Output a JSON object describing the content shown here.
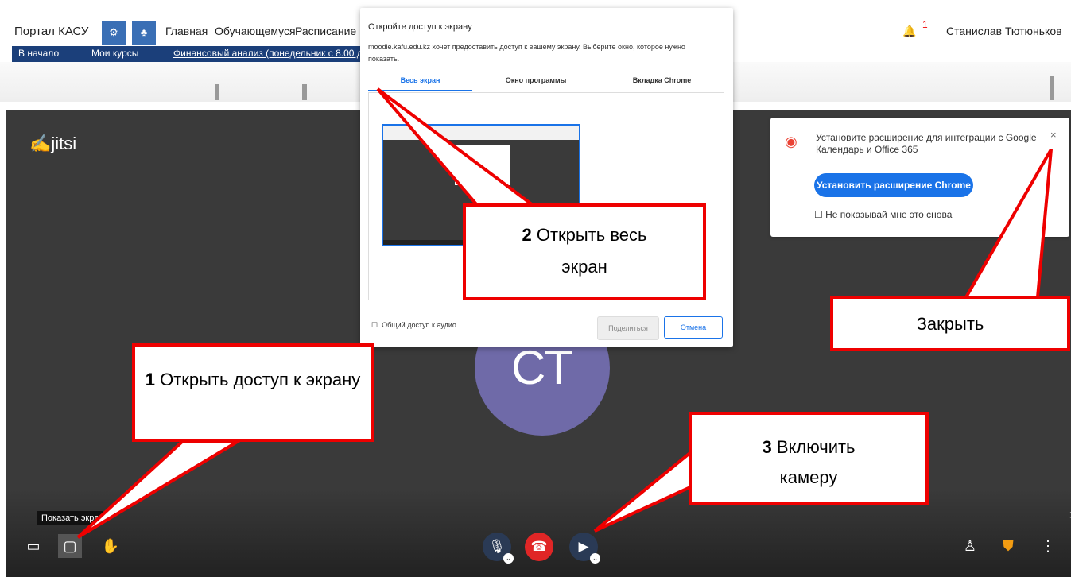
{
  "moodle": {
    "site_name": "Портал КАСУ",
    "nav_items": [
      "Главная",
      "Обучающемуся",
      "Расписание"
    ],
    "user_name": "Станислав Тютюньков",
    "notification_count": "1",
    "breadcrumbs": [
      "В начало",
      "Мои курсы",
      "Финансовый анализ (понедельник с 8.00 д"
    ]
  },
  "jitsi": {
    "logo": "jitsi",
    "avatar_initials": "СТ",
    "tooltip": "Показать экра"
  },
  "extension_popup": {
    "text": "Установите расширение для интеграции с Google Календарь и Office 365",
    "button": "Установить расширение Chrome",
    "checkbox_label": "Не показывай мне это снова",
    "close": "×"
  },
  "share_dialog": {
    "title": "Откройте доступ к экрану",
    "description": "moodle.kafu.edu.kz хочет предоставить доступ к вашему экрану. Выберите окно, которое нужно показать.",
    "tabs": [
      "Весь экран",
      "Окно программы",
      "Вкладка Chrome"
    ],
    "audio_label": "Общий доступ к аудио",
    "share_button": "Поделиться",
    "cancel_button": "Отмена"
  },
  "callouts": {
    "c1_num": "1",
    "c1_text": "Открыть доступ к экрану",
    "c2_num": "2",
    "c2_text": "Открыть весь экран",
    "c3_num": "3",
    "c3_text": "Включить камеру",
    "close_text": "Закрыть"
  },
  "colors": {
    "accent": "#1a73e8",
    "callout_border": "#e00000",
    "hangup": "#e02626",
    "avatar": "#6f6aa8"
  }
}
